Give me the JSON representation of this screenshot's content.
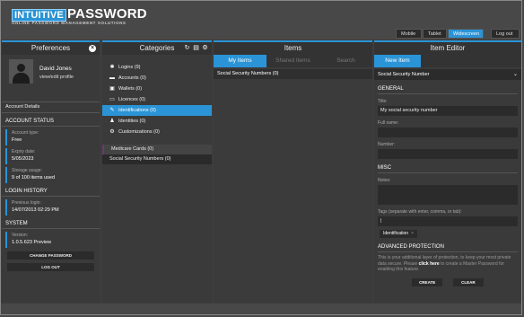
{
  "app": {
    "logo_word1": "INTUITIVE",
    "logo_word2": "PASSWORD",
    "logo_tagline": "ONLINE PASSWORD MANAGEMENT SOLUTIONS",
    "accent": "#2a94d6"
  },
  "toolbar": {
    "buttons": [
      "Mobile",
      "Tablet",
      "Widescreen",
      "Log out"
    ],
    "active": "Widescreen"
  },
  "preferences": {
    "title": "Preferences",
    "user_name": "David Jones",
    "view_profile": "view/edit profile",
    "account_details": "Account Details",
    "account_status_heading": "ACCOUNT STATUS",
    "account_type_label": "Account type:",
    "account_type_value": "Free",
    "expiry_label": "Expiry date:",
    "expiry_value": "5/05/2023",
    "storage_label": "Storage usage:",
    "storage_value": "9 of 100 items used",
    "login_history_heading": "LOGIN HISTORY",
    "previous_login_label": "Previous login:",
    "previous_login_value": "14/07/2013 02:29 PM",
    "system_heading": "SYSTEM",
    "version_label": "Version:",
    "version_value": "1.0.5.623 Preview",
    "change_password": "CHANGE PASSWORD",
    "log_out": "LOG OUT"
  },
  "categories": {
    "title": "Categories",
    "items": [
      {
        "icon": "key-icon",
        "glyph": "✱",
        "label": "Logins (9)"
      },
      {
        "icon": "card-icon",
        "glyph": "▬",
        "label": "Accounts (0)"
      },
      {
        "icon": "wallet-icon",
        "glyph": "▣",
        "label": "Wallets (0)"
      },
      {
        "icon": "licence-icon",
        "glyph": "▭",
        "label": "Licences (0)"
      },
      {
        "icon": "id-icon",
        "glyph": "✎",
        "label": "Identifications (0)"
      },
      {
        "icon": "people-icon",
        "glyph": "♟",
        "label": "Identities (0)"
      },
      {
        "icon": "gears-icon",
        "glyph": "⚙",
        "label": "Customizations (0)"
      }
    ],
    "active_index": 4,
    "custom": [
      "Medicare Cards (0)",
      "Social Security Numbers (0)"
    ]
  },
  "items": {
    "title": "Items",
    "tabs": [
      "My Items",
      "Shared Items",
      "Search"
    ],
    "rows": [
      "Social Security Numbers (0)"
    ]
  },
  "editor": {
    "title": "Item Editor",
    "new_item_tab": "New Item",
    "type_value": "Social Security Number",
    "general_heading": "GENERAL",
    "title_label": "Title:",
    "title_value": "My social security number",
    "fullname_label": "Full name:",
    "fullname_value": "",
    "number_label": "Number:",
    "number_value": "",
    "misc_heading": "MISC",
    "notes_label": "Notes:",
    "tags_label": "Tags (separate with enter, comma, or tab):",
    "tags_input": "|",
    "tag_chip": "Identification",
    "advanced_heading": "ADVANCED PROTECTION",
    "advanced_text_1": "This is your additional layer of protection, to keep your most private data secure. Please",
    "advanced_link": "click here",
    "advanced_text_2": "to create a Master Password for enabling this feature.",
    "create_button": "CREATE",
    "clear_button": "CLEAR"
  }
}
